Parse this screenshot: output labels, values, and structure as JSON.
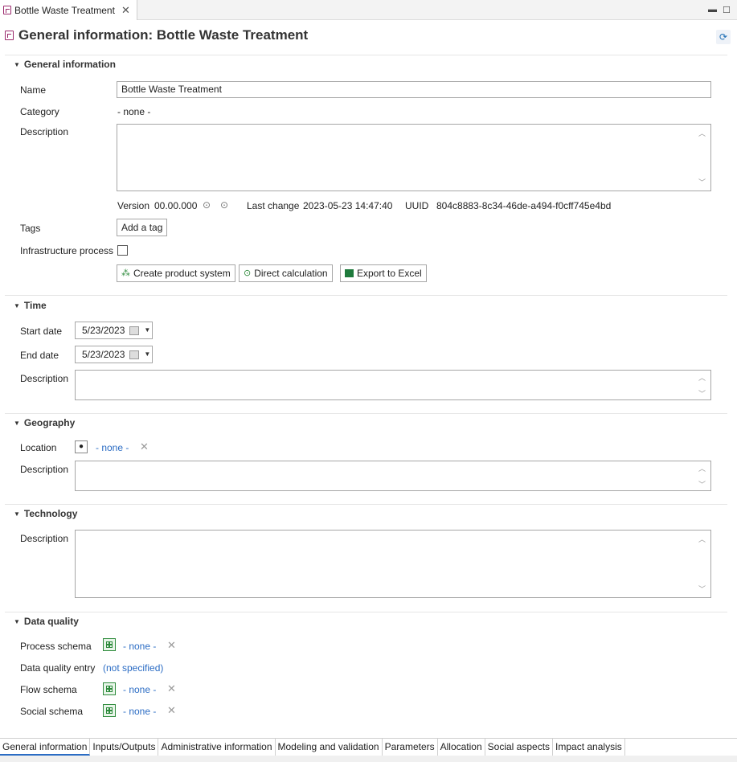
{
  "tab": {
    "title": "Bottle Waste Treatment"
  },
  "header": {
    "title": "General information: Bottle Waste Treatment"
  },
  "general": {
    "section_title": "General information",
    "name_label": "Name",
    "name_value": "Bottle Waste Treatment",
    "category_label": "Category",
    "category_value": "- none -",
    "description_label": "Description",
    "version_label": "Version",
    "version_value": "00.00.000",
    "last_change_label": "Last change",
    "last_change_value": "2023-05-23 14:47:40",
    "uuid_label": "UUID",
    "uuid_value": "804c8883-8c34-46de-a494-f0cff745e4bd",
    "tags_label": "Tags",
    "add_tag_label": "Add a tag",
    "infrastructure_label": "Infrastructure process",
    "create_product_system_label": "Create product system",
    "direct_calculation_label": "Direct calculation",
    "export_excel_label": "Export to Excel"
  },
  "time": {
    "section_title": "Time",
    "start_label": "Start date",
    "start_value": "5/23/2023",
    "end_label": "End date",
    "end_value": "5/23/2023",
    "description_label": "Description"
  },
  "geography": {
    "section_title": "Geography",
    "location_label": "Location",
    "location_value": "- none -",
    "description_label": "Description"
  },
  "technology": {
    "section_title": "Technology",
    "description_label": "Description"
  },
  "data_quality": {
    "section_title": "Data quality",
    "process_schema_label": "Process schema",
    "process_schema_value": "- none -",
    "entry_label": "Data quality entry",
    "entry_value": "(not specified)",
    "flow_schema_label": "Flow schema",
    "flow_schema_value": "- none -",
    "social_schema_label": "Social schema",
    "social_schema_value": "- none -"
  },
  "bottom_tabs": [
    "General information",
    "Inputs/Outputs",
    "Administrative information",
    "Modeling and validation",
    "Parameters",
    "Allocation",
    "Social aspects",
    "Impact analysis"
  ],
  "colors": {
    "accent": "#2b6cc4",
    "process_icon": "#9b2a6d"
  }
}
